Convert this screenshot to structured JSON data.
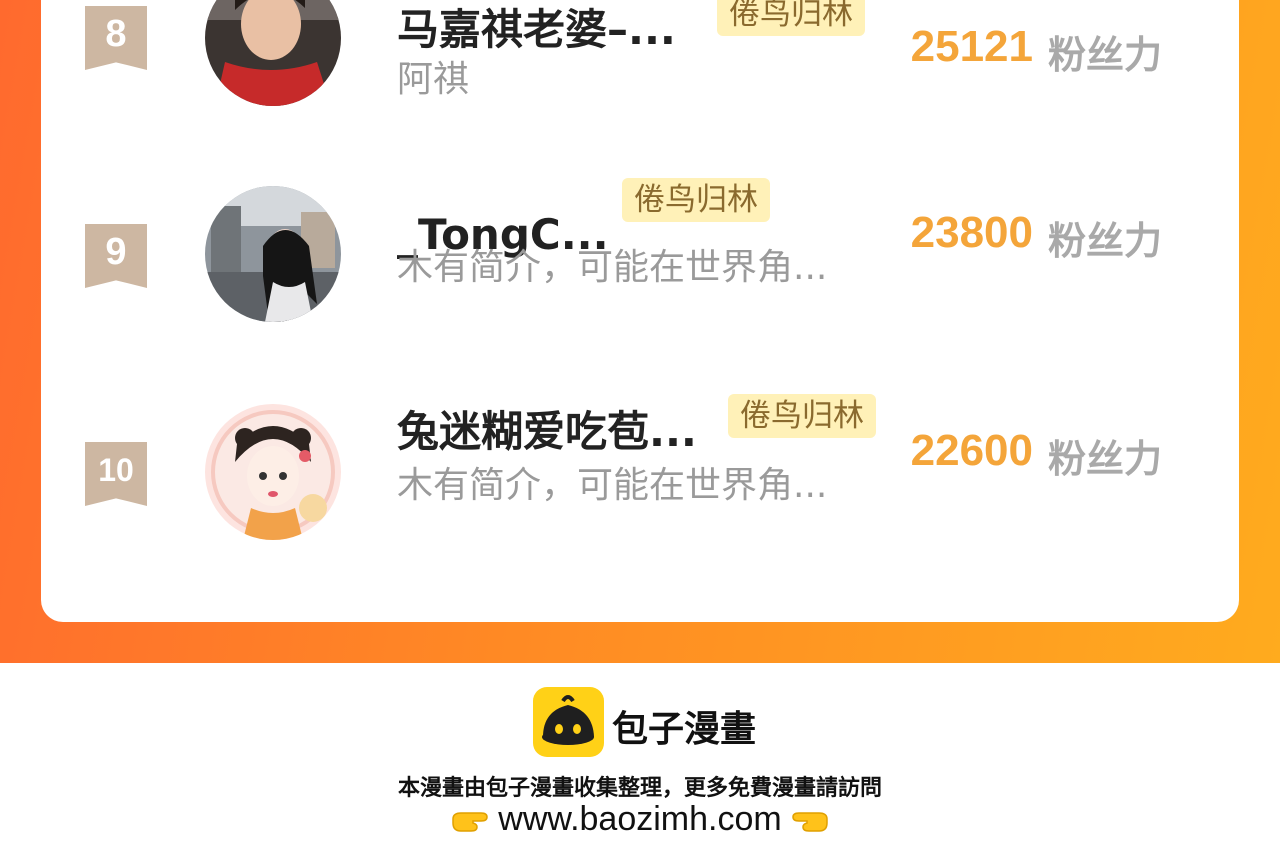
{
  "ranking": {
    "unit_label": "粉丝力",
    "items": [
      {
        "rank": "8",
        "name": "马嘉祺老婆–...",
        "tag": "倦鸟归林",
        "bio": "阿祺",
        "score": "25121"
      },
      {
        "rank": "9",
        "name": "_TongC...",
        "tag": "倦鸟归林",
        "bio": "木有简介，可能在世界角...",
        "score": "23800"
      },
      {
        "rank": "10",
        "name": "兔迷糊爱吃苞...",
        "tag": "倦鸟归林",
        "bio": "木有简介，可能在世界角...",
        "score": "22600"
      }
    ]
  },
  "footer": {
    "brand": "包子漫畫",
    "note": "本漫畫由包子漫畫收集整理，更多免費漫畫請訪問",
    "url": "www.baozimh.com",
    "logo_color": "#ffd117"
  },
  "colors": {
    "accent": "#ff7a28",
    "score": "#f4a53a",
    "tag_bg": "#fff1b8",
    "rank_badge": "#cdb7a2"
  }
}
